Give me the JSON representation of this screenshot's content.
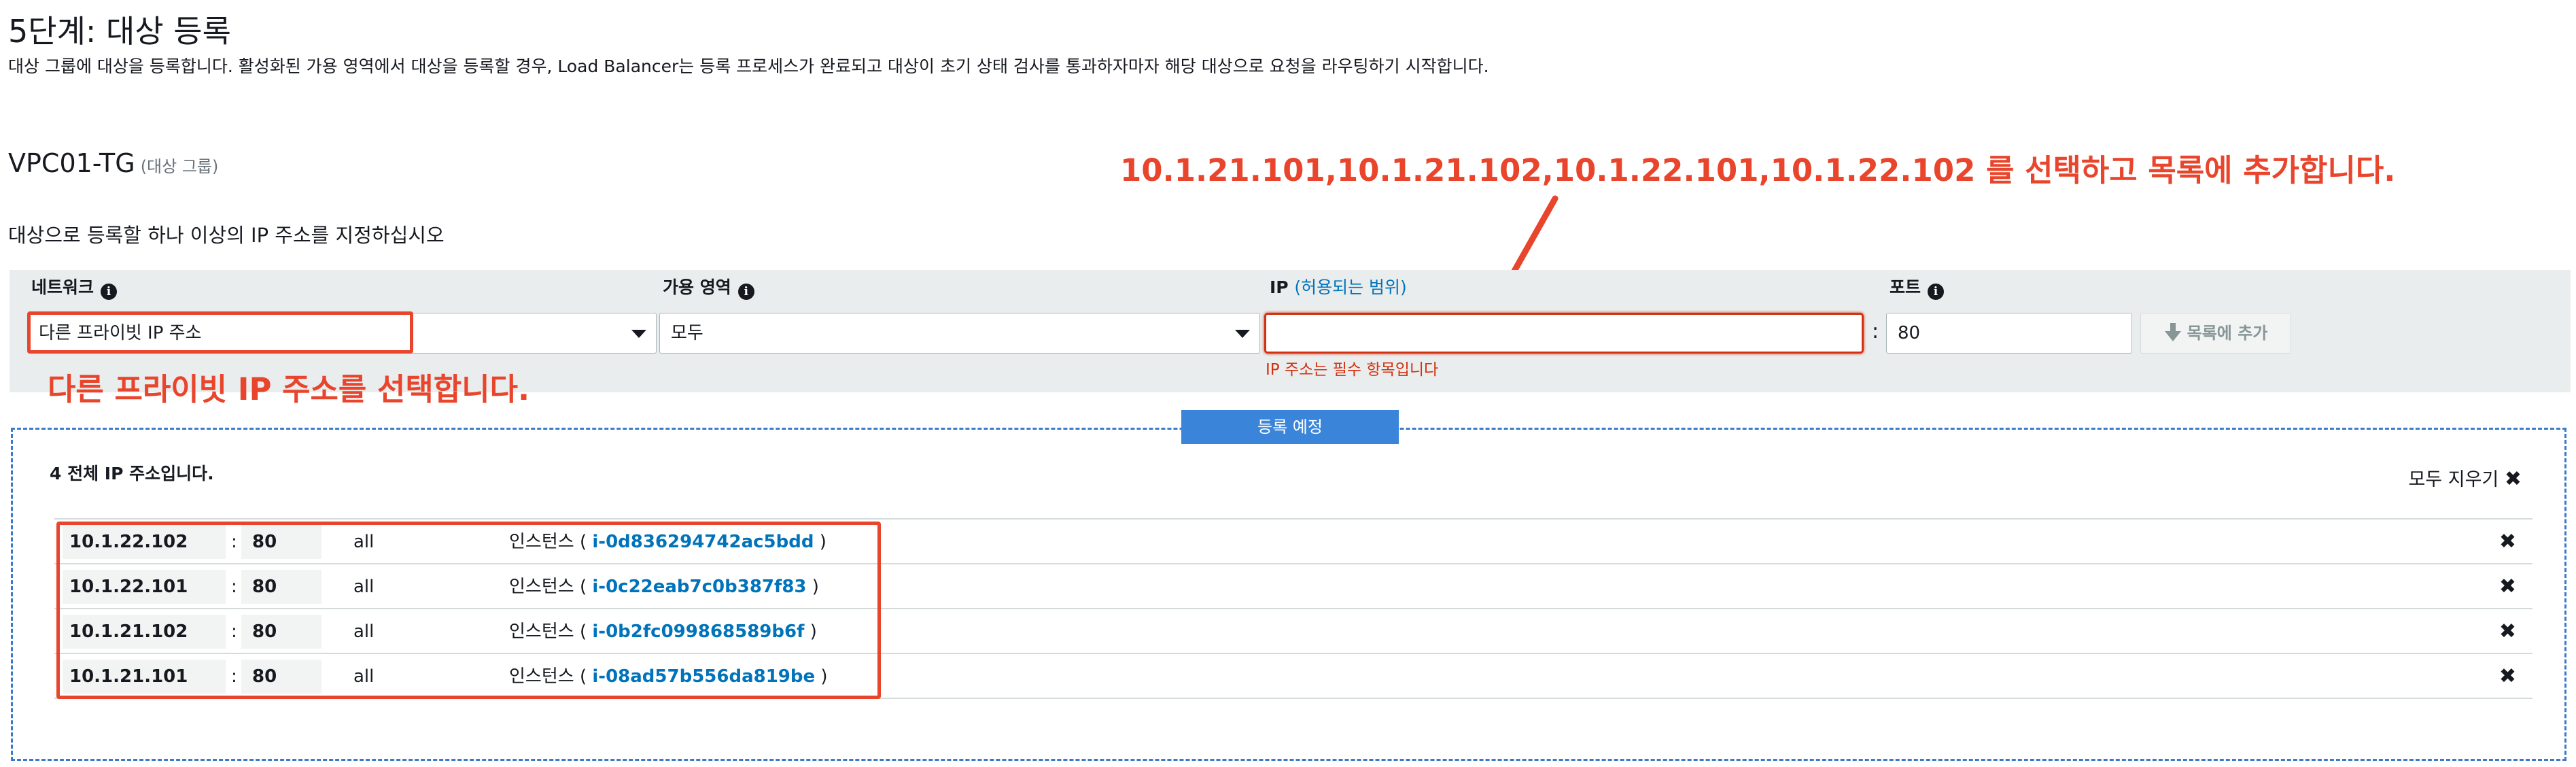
{
  "page": {
    "title": "5단계: 대상 등록",
    "description": "대상 그룹에 대상을 등록합니다. 활성화된 가용 영역에서 대상을 등록할 경우, Load Balancer는 등록 프로세스가 완료되고 대상이 초기 상태 검사를 통과하자마자 해당 대상으로 요청을 라우팅하기 시작합니다."
  },
  "target_group": {
    "name": "VPC01-TG",
    "sub": "(대상 그룹)"
  },
  "instruction": "대상으로 등록할 하나 이상의 IP 주소를 지정하십시오",
  "form": {
    "network_label": "네트워크",
    "network_value": "다른 프라이빗 IP 주소",
    "az_label": "가용 영역",
    "az_value": "모두",
    "ip_label": "IP",
    "ip_range_link": "(허용되는 범위)",
    "ip_value": "",
    "ip_error": "IP 주소는 필수 항목입니다",
    "port_label": "포트",
    "port_value": "80",
    "add_button": "목록에 추가"
  },
  "annotations": {
    "top": "10.1.21.101,10.1.21.102,10.1.22.101,10.1.22.102 를 선택하고 목록에 추가합니다.",
    "network": "다른 프라이빗 IP 주소를 선택합니다."
  },
  "pending": {
    "tab_label": "등록 예정",
    "count_text": "4 전체 IP 주소입니다.",
    "clear_all": "모두 지우기",
    "rows": [
      {
        "ip": "10.1.22.102",
        "port": "80",
        "az": "all",
        "inst_prefix": "인스턴스 (",
        "instance": "i-0d836294742ac5bdd",
        "inst_suffix": ")"
      },
      {
        "ip": "10.1.22.101",
        "port": "80",
        "az": "all",
        "inst_prefix": "인스턴스 (",
        "instance": "i-0c22eab7c0b387f83",
        "inst_suffix": ")"
      },
      {
        "ip": "10.1.21.102",
        "port": "80",
        "az": "all",
        "inst_prefix": "인스턴스 (",
        "instance": "i-0b2fc099868589b6f",
        "inst_suffix": ")"
      },
      {
        "ip": "10.1.21.101",
        "port": "80",
        "az": "all",
        "inst_prefix": "인스턴스 (",
        "instance": "i-08ad57b556da819be",
        "inst_suffix": ")"
      }
    ]
  },
  "colors": {
    "annotation": "#e8452c",
    "link": "#0073bb",
    "error": "#d13212",
    "tab": "#3a84d9"
  }
}
